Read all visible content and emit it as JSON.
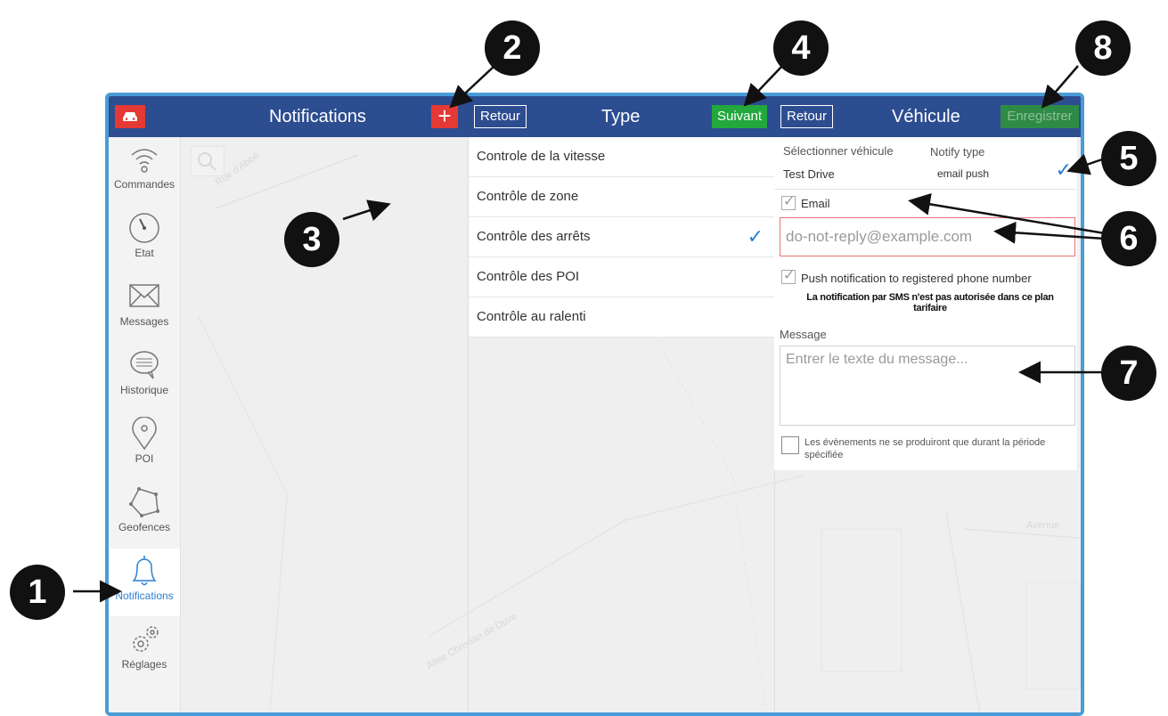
{
  "topbar": {
    "notifications_title": "Notifications",
    "add_label": "+",
    "back1_label": "Retour",
    "type_title": "Type",
    "next_label": "Suivant",
    "back2_label": "Retour",
    "vehicle_title": "Véhicule",
    "save_label": "Enregistrer"
  },
  "sidebar": {
    "items": [
      {
        "label": "Commandes",
        "icon": "wifi-signal-icon"
      },
      {
        "label": "Etat",
        "icon": "gauge-icon"
      },
      {
        "label": "Messages",
        "icon": "envelope-icon"
      },
      {
        "label": "Historique",
        "icon": "chat-bubble-icon"
      },
      {
        "label": "POI",
        "icon": "map-pin-icon"
      },
      {
        "label": "Geofences",
        "icon": "polygon-icon"
      },
      {
        "label": "Notifications",
        "icon": "bell-icon"
      },
      {
        "label": "Réglages",
        "icon": "gears-icon"
      }
    ],
    "active": "Notifications"
  },
  "types": [
    {
      "label": "Controle de la vitesse",
      "selected": false
    },
    {
      "label": "Contrôle de zone",
      "selected": false
    },
    {
      "label": "Contrôle des arrêts",
      "selected": true
    },
    {
      "label": "Contrôle des POI",
      "selected": false
    },
    {
      "label": "Contrôle au ralenti",
      "selected": false
    }
  ],
  "vehicle_panel": {
    "select_vehicle_label": "Sélectionner véhicule",
    "notify_type_label": "Notify type",
    "vehicle_name": "Test Drive",
    "notify_types": "email  push",
    "check_mark": "✓",
    "email_label": "Email",
    "email_placeholder": "do-not-reply@example.com",
    "push_label": "Push notification to registered phone number",
    "sms_notice": "La notification par SMS n'est pas autorisée dans ce plan tarifaire",
    "message_label": "Message",
    "message_placeholder": "Entrer le texte du message...",
    "period_label": "Les évènements ne se produiront que durant la période spécifiée"
  },
  "map_labels": [
    "Rue d'Abbé",
    "Allée Christian de Duve",
    "Avenue"
  ],
  "callouts": [
    "1",
    "2",
    "3",
    "4",
    "5",
    "6",
    "7",
    "8"
  ],
  "colors": {
    "topbar": "#2d4d91",
    "accent_red": "#e53935",
    "accent_green": "#22a83c",
    "active_blue": "#2b7fcf",
    "frame_border": "#4a9cd6"
  }
}
